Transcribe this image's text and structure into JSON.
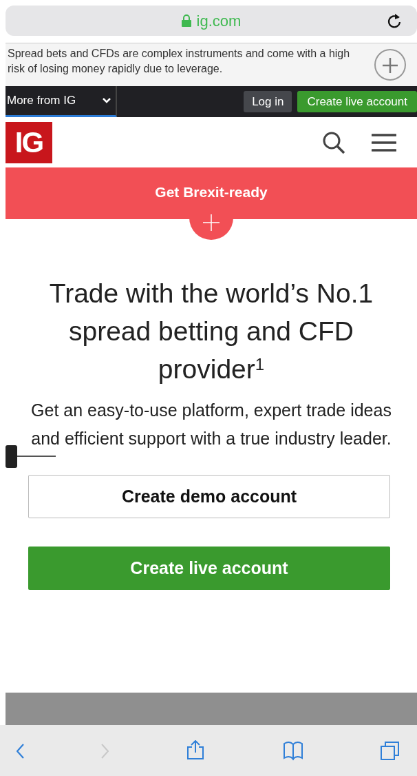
{
  "browser": {
    "url": "ig.com"
  },
  "risk_warning": {
    "text": "Spread bets and CFDs are complex instruments and come with a high risk of losing money rapidly due to leverage.",
    "expanded": false
  },
  "top_bar": {
    "menu_label": "More from IG",
    "login": "Log in",
    "create_live": "Create live account"
  },
  "header": {
    "logo": "IG"
  },
  "banner": {
    "text": "Get Brexit-ready",
    "expanded": false
  },
  "hero": {
    "heading": "Trade with the world’s No.1 spread betting and CFD provider$^{1}$",
    "subtext": "Get an easy-to-use platform, expert trade ideas and efficient support with a true industry leader."
  },
  "buttons": [
    {
      "kind": "outline",
      "label": "Create demo account"
    },
    {
      "kind": "primary",
      "label": "Create live account"
    }
  ],
  "toolbar": [
    {
      "kind": "back",
      "disabled": false
    },
    {
      "kind": "forward",
      "disabled": true
    },
    {
      "kind": "share",
      "disabled": false
    },
    {
      "kind": "bookmarks",
      "disabled": false
    },
    {
      "kind": "tabs",
      "disabled": false
    }
  ]
}
